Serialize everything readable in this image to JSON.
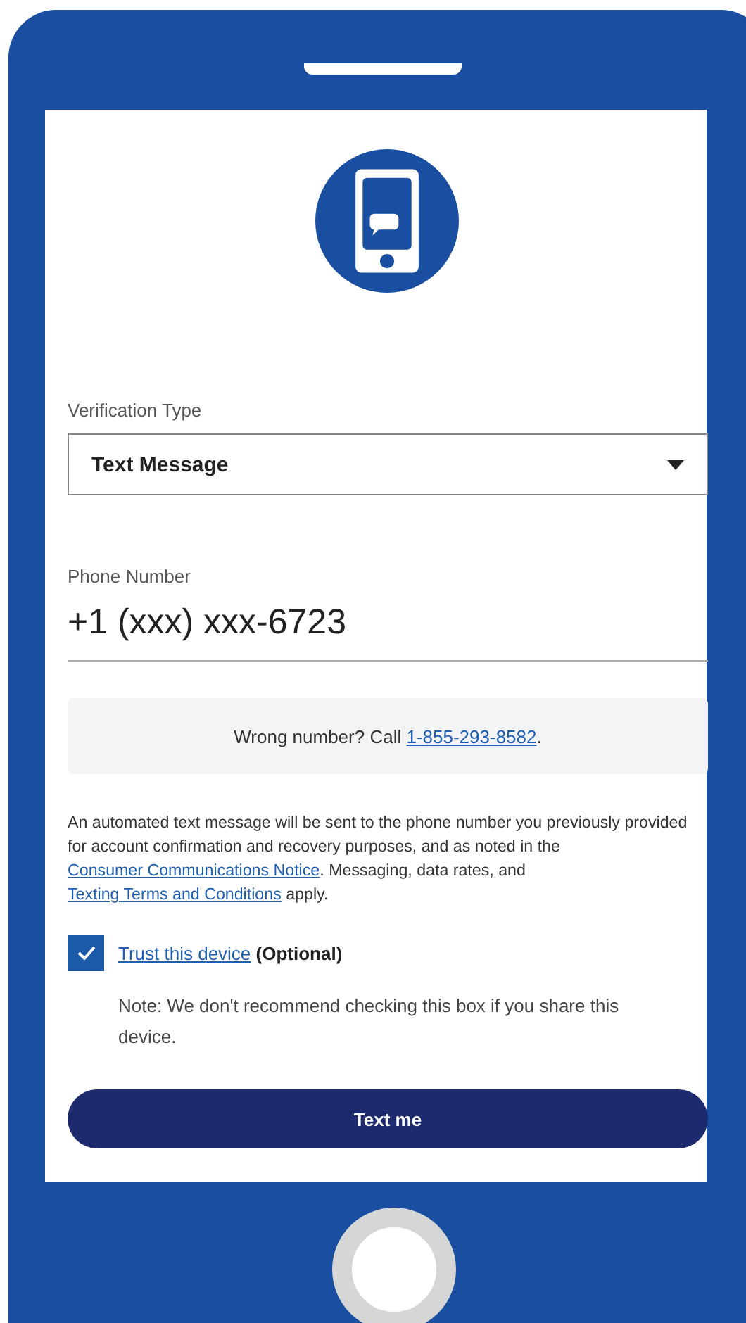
{
  "verification_type": {
    "label": "Verification Type",
    "value": "Text Message"
  },
  "phone_number": {
    "label": "Phone Number",
    "value": "+1 (xxx) xxx-6723"
  },
  "wrong_number_notice": [
    {
      "text": "Wrong number? Call ",
      "link": false
    },
    {
      "text": "1-855-293-8582",
      "link": true
    },
    {
      "text": ".",
      "link": false
    }
  ],
  "disclaimer": [
    {
      "text": "An automated text message will be sent to the phone number you previously provided for account confirmation and recovery purposes, and as noted in the ",
      "link": false
    },
    {
      "text": "Consumer Communications Notice",
      "link": true
    },
    {
      "text": ". Messaging, data rates, and ",
      "link": false
    },
    {
      "text": "Texting Terms and Conditions",
      "link": true
    },
    {
      "text": " apply.",
      "link": false
    }
  ],
  "trust_device": {
    "link": "Trust this device",
    "suffix": "(Optional)",
    "checked": true,
    "note": "Note: We don't recommend checking this box if you share this device."
  },
  "submit_button": "Text me"
}
